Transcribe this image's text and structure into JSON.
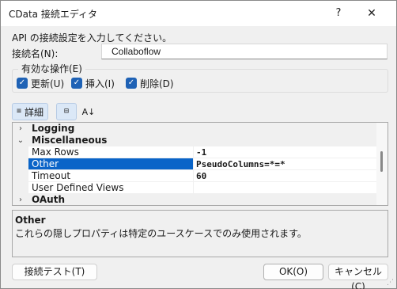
{
  "window": {
    "title": "CData 接続エディタ",
    "help": "?",
    "close": "✕"
  },
  "intro_text": "API の接続設定を入力してください。",
  "connection": {
    "label": "接続名(N):",
    "value": "Collaboflow"
  },
  "operations": {
    "legend": "有効な操作(E)",
    "items": [
      {
        "label": "更新(U)",
        "checked": true
      },
      {
        "label": "挿入(I)",
        "checked": true
      },
      {
        "label": "削除(D)",
        "checked": true
      }
    ]
  },
  "toolbar": {
    "details_label": "詳細",
    "sort_label": "A↓"
  },
  "property_grid": {
    "categories": [
      {
        "name": "Logging",
        "expanded": false
      },
      {
        "name": "Miscellaneous",
        "expanded": true
      },
      {
        "name": "OAuth",
        "expanded": false
      }
    ],
    "properties": [
      {
        "name": "Max Rows",
        "value": "-1"
      },
      {
        "name": "Other",
        "value": "PseudoColumns=*=*",
        "selected": true
      },
      {
        "name": "Timeout",
        "value": "60"
      },
      {
        "name": "User Defined Views",
        "value": ""
      }
    ]
  },
  "description": {
    "title": "Other",
    "text": "これらの隠しプロパティは特定のユースケースでのみ使用されます。"
  },
  "buttons": {
    "test": "接続テスト(T)",
    "ok": "OK(O)",
    "cancel": "キャンセル(C)"
  },
  "colors": {
    "selection": "#0a64c8",
    "checkbox": "#1f62b5",
    "toolbar_active": "#dbe8f7"
  }
}
